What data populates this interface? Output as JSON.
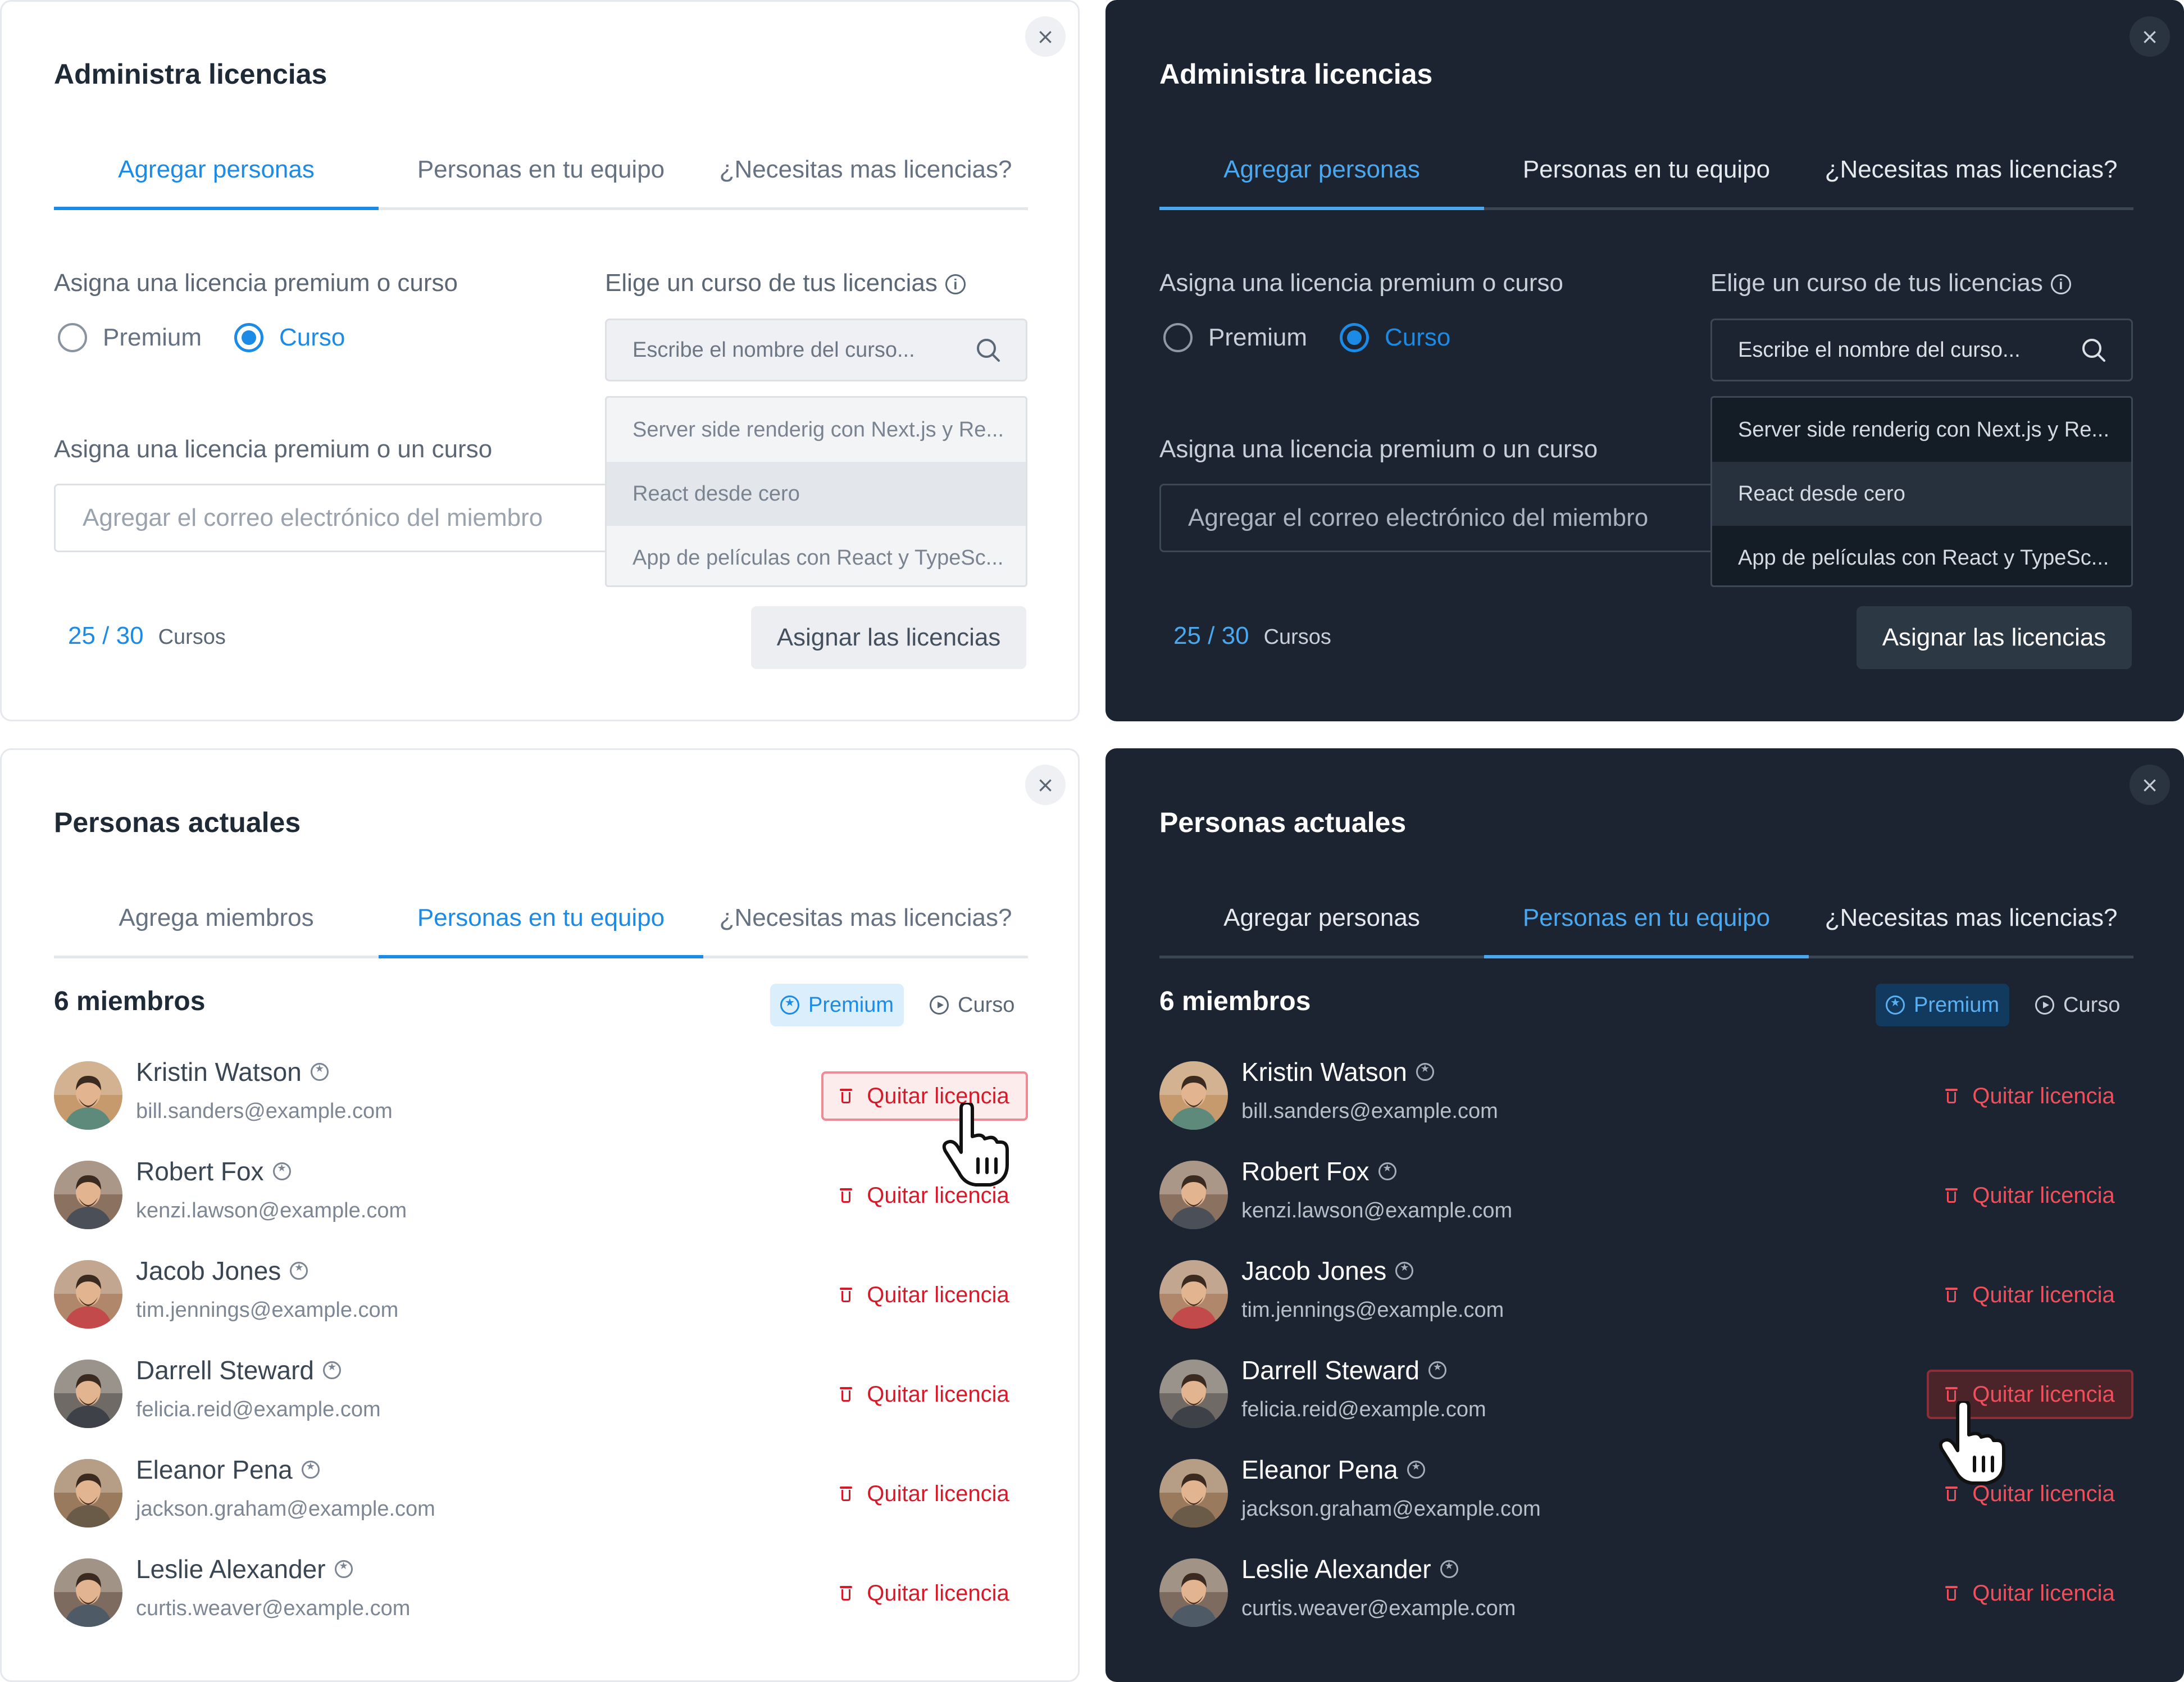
{
  "licenses_modal": {
    "title": "Administra licencias",
    "tabs": [
      "Agregar personas",
      "Personas en tu equipo",
      "¿Necesitas mas licencias?"
    ],
    "assign_label": "Asigna una licencia premium o curso",
    "radio_premium": "Premium",
    "radio_curso": "Curso",
    "course_label": "Elige un curso de tus licencias",
    "info_icon": "i",
    "search_placeholder": "Escribe el nombre del curso...",
    "courses": [
      "Server side renderig con Next.js y Re...",
      "React desde cero",
      "App de películas con React y TypeSc..."
    ],
    "email_label": "Asigna una licencia premium o un curso",
    "email_placeholder": "Agregar el correo electrónico del miembro",
    "count": "25 / 30",
    "count_unit": "Cursos",
    "assign_button": "Asignar las licencias",
    "close": "×"
  },
  "people_modal_light": {
    "title": "Personas actuales",
    "tabs": [
      "Agrega miembros",
      "Personas en tu equipo",
      "¿Necesitas mas licencias?"
    ]
  },
  "people_modal_dark": {
    "title": "Personas actuales",
    "tabs": [
      "Agregar personas",
      "Personas en tu equipo",
      "¿Necesitas mas licencias?"
    ]
  },
  "members_title": "6 miembros",
  "filters": {
    "premium": "Premium",
    "curso": "Curso"
  },
  "remove_label": "Quitar licencia",
  "members": [
    {
      "name": "Kristin Watson",
      "email": "bill.sanders@example.com"
    },
    {
      "name": "Robert Fox",
      "email": "kenzi.lawson@example.com"
    },
    {
      "name": "Jacob Jones",
      "email": "tim.jennings@example.com"
    },
    {
      "name": "Darrell Steward",
      "email": "felicia.reid@example.com"
    },
    {
      "name": "Eleanor Pena",
      "email": "jackson.graham@example.com"
    },
    {
      "name": "Leslie Alexander",
      "email": "curtis.weaver@example.com"
    }
  ],
  "colors": {
    "accent": "#1b8be6",
    "danger": "#d71a2a",
    "dark_bg": "#1b2430",
    "light_bg": "#ffffff"
  }
}
